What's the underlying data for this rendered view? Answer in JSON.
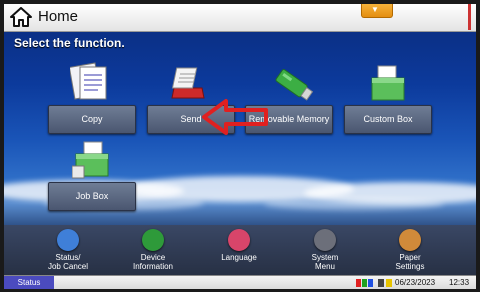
{
  "header": {
    "title": "Home",
    "tab_icon": "chevron-down-icon"
  },
  "subtitle": "Select the function.",
  "functions": [
    {
      "label": "Copy",
      "icon": "copy-icon"
    },
    {
      "label": "Send",
      "icon": "send-icon"
    },
    {
      "label": "Removable Memory",
      "icon": "usb-drive-icon"
    },
    {
      "label": "Custom Box",
      "icon": "document-box-icon"
    },
    {
      "label": "Job Box",
      "icon": "job-box-icon"
    }
  ],
  "annotation": {
    "color": "#e02020",
    "points_to": "Send"
  },
  "footer": {
    "items": [
      {
        "label_line1": "Status/",
        "label_line2": "Job Cancel",
        "icon": "status-icon",
        "color": "#3f7fd8"
      },
      {
        "label_line1": "Device",
        "label_line2": "Information",
        "icon": "device-icon",
        "color": "#2e9a3a"
      },
      {
        "label_line1": "Language",
        "label_line2": "",
        "icon": "language-icon",
        "color": "#d8456a"
      },
      {
        "label_line1": "System",
        "label_line2": "Menu",
        "icon": "system-menu-icon",
        "color": "#6c6f7a"
      },
      {
        "label_line1": "Paper",
        "label_line2": "Settings",
        "icon": "paper-settings-icon",
        "color": "#d08a3a"
      }
    ]
  },
  "statusbar": {
    "status_label": "Status",
    "date": "06/23/2023",
    "time": "12:33",
    "indicator_colors": [
      "#e02020",
      "#20a020",
      "#2050e0",
      "#e8c400"
    ]
  }
}
